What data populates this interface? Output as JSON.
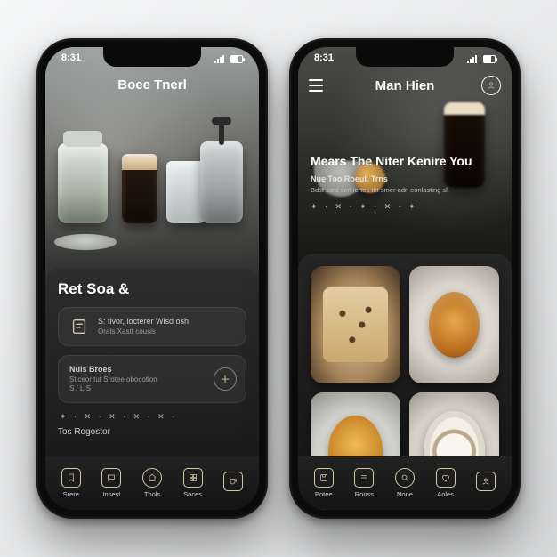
{
  "status": {
    "time": "8:31"
  },
  "phone1": {
    "header_title": "Boee Tnerl",
    "section_heading": "Ret Soa &",
    "card1": {
      "line1": "S: tivor, locterer Wisd osh",
      "line2": "Orats Xastt cousis"
    },
    "card2": {
      "line1": "Nuls Broes",
      "line2": "Sticeor tut Srotee obocotlon",
      "line3": "S / LIS"
    },
    "dots_row": "✦ · ✕ · ✕ · ✕ · ✕ ·",
    "footer_label": "Tos Rogostor",
    "tabs": [
      {
        "label": "Srere"
      },
      {
        "label": "Insest"
      },
      {
        "label": "Tbols"
      },
      {
        "label": "Soces"
      },
      {
        "label": ""
      }
    ]
  },
  "phone2": {
    "header_title": "Man Hien",
    "hero_heading": "Mears  The Niter Kenire You",
    "hero_sub": "Nue Too Roeul. Trns",
    "hero_body": "Bdst sard serl iertes tht smer adn eonlasting sl.",
    "hero_symbols": "✦ · ✕ · ✦ · ✕ · ✦",
    "tiles": [
      {
        "name": "cookie"
      },
      {
        "name": "soup"
      },
      {
        "name": "curry"
      },
      {
        "name": "coffee"
      }
    ],
    "tabs": [
      {
        "label": "Potee"
      },
      {
        "label": "Ronss"
      },
      {
        "label": "None"
      },
      {
        "label": "Aoles"
      },
      {
        "label": ""
      }
    ]
  }
}
